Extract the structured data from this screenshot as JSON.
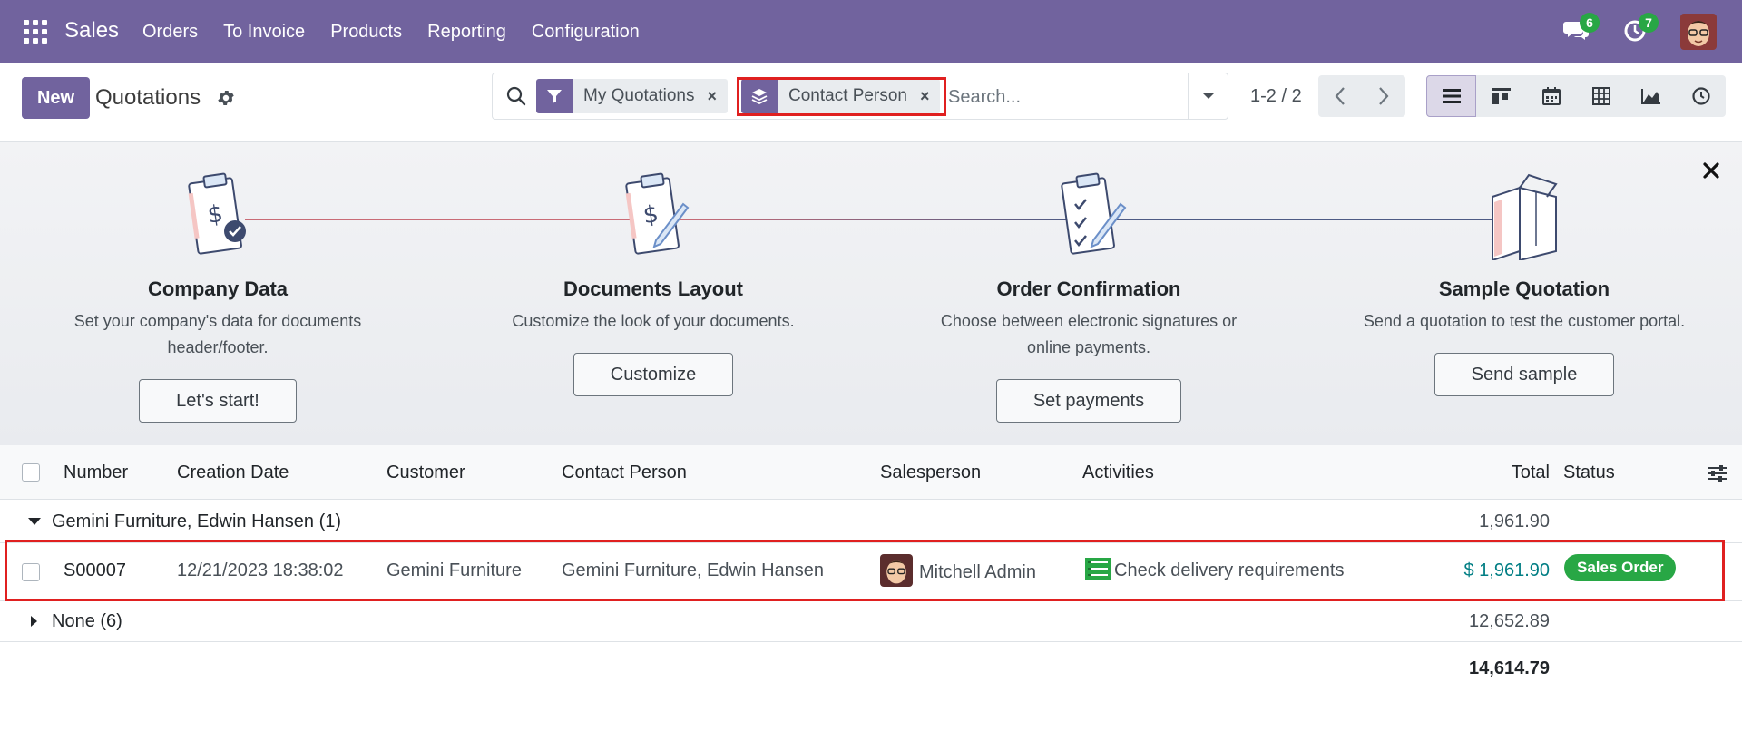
{
  "navbar": {
    "app_name": "Sales",
    "menu": [
      "Orders",
      "To Invoice",
      "Products",
      "Reporting",
      "Configuration"
    ],
    "messages_count": "6",
    "activities_count": "7",
    "color": "#71639e"
  },
  "control": {
    "new_label": "New",
    "title": "Quotations",
    "search": {
      "facets": [
        {
          "icon": "filter-icon",
          "label": "My Quotations"
        },
        {
          "icon": "layers-icon",
          "label": "Contact Person"
        }
      ],
      "remove_glyph": "×",
      "placeholder": "Search..."
    },
    "pager": "1-2 / 2",
    "views": [
      "list-view-icon",
      "kanban-view-icon",
      "calendar-view-icon",
      "pivot-view-icon",
      "graph-view-icon",
      "activity-view-icon"
    ]
  },
  "onboarding": {
    "steps": [
      {
        "title": "Company Data",
        "description": "Set your company's data for documents header/footer.",
        "button": "Let's start!"
      },
      {
        "title": "Documents Layout",
        "description": "Customize the look of your documents.",
        "button": "Customize"
      },
      {
        "title": "Order Confirmation",
        "description": "Choose between electronic signatures or online payments.",
        "button": "Set payments"
      },
      {
        "title": "Sample Quotation",
        "description": "Send a quotation to test the customer portal.",
        "button": "Send sample"
      }
    ]
  },
  "list": {
    "columns": [
      "Number",
      "Creation Date",
      "Customer",
      "Contact Person",
      "Salesperson",
      "Activities",
      "Total",
      "Status"
    ],
    "groups": [
      {
        "label": "Gemini Furniture, Edwin Hansen (1)",
        "total": "1,961.90",
        "expanded": true,
        "rows": [
          {
            "number": "S00007",
            "creation_date": "12/21/2023 18:38:02",
            "customer": "Gemini Furniture",
            "contact_person": "Gemini Furniture, Edwin Hansen",
            "salesperson": "Mitchell Admin",
            "activity": "Check delivery requirements",
            "total": "$ 1,961.90",
            "status": "Sales Order"
          }
        ]
      },
      {
        "label": "None (6)",
        "total": "12,652.89",
        "expanded": false
      }
    ],
    "grand_total": "14,614.79"
  },
  "colors": {
    "primary": "#71639e",
    "status_green": "#28a745",
    "total_teal": "#017e84",
    "highlight_red": "#e02020"
  }
}
